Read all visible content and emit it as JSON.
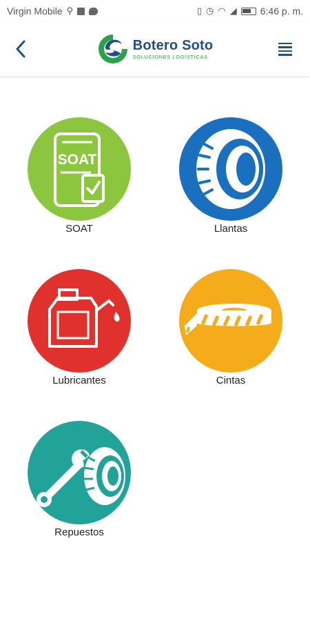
{
  "status_bar": {
    "carrier": "Virgin Mobile",
    "time": "6:46 p. m."
  },
  "header": {
    "brand_name": "Botero Soto",
    "brand_tagline": "SOLUCIONES LOGÍSTICAS"
  },
  "colors": {
    "brand_blue": "#1e4e8c",
    "brand_green": "#2ba14a",
    "soat": "#8cc63f",
    "llantas": "#1a6fbf",
    "lubricantes": "#e1312c",
    "cintas": "#f4ac1a",
    "repuestos": "#21a39a"
  },
  "menu": {
    "items": [
      {
        "label": "SOAT",
        "icon": "soat-document-icon"
      },
      {
        "label": "Llantas",
        "icon": "tire-icon"
      },
      {
        "label": "Lubricantes",
        "icon": "oil-can-icon"
      },
      {
        "label": "Cintas",
        "icon": "reflective-tape-icon"
      },
      {
        "label": "Repuestos",
        "icon": "wrench-tire-icon"
      }
    ],
    "soat_icon_text": "SOAT"
  }
}
